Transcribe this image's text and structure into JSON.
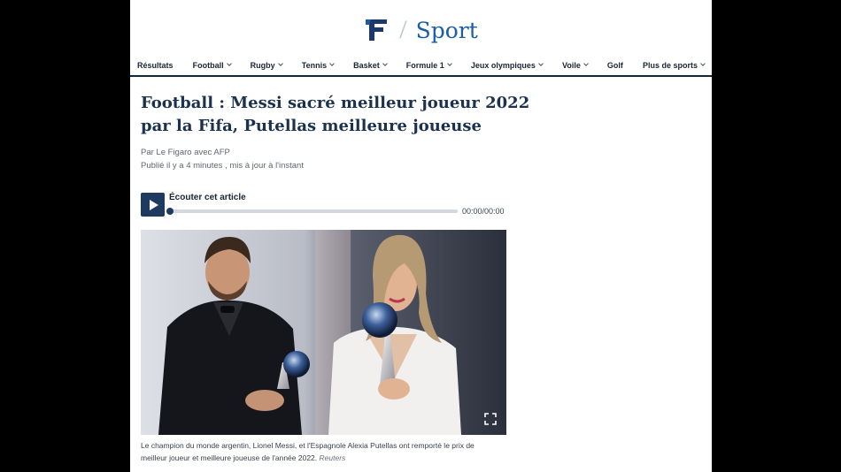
{
  "header": {
    "brand_section": "Sport",
    "logo_icon": "le-figaro-f-logo-icon"
  },
  "nav": {
    "items": [
      {
        "label": "Résultats",
        "has_dropdown": false
      },
      {
        "label": "Football",
        "has_dropdown": true
      },
      {
        "label": "Rugby",
        "has_dropdown": true
      },
      {
        "label": "Tennis",
        "has_dropdown": true
      },
      {
        "label": "Basket",
        "has_dropdown": true
      },
      {
        "label": "Formule 1",
        "has_dropdown": true
      },
      {
        "label": "Jeux olympiques",
        "has_dropdown": true
      },
      {
        "label": "Voile",
        "has_dropdown": true
      },
      {
        "label": "Golf",
        "has_dropdown": false
      },
      {
        "label": "Plus de sports",
        "has_dropdown": true
      }
    ]
  },
  "article": {
    "title": "Football : Messi sacré meilleur joueur 2022 par la Fifa, Putellas meilleure joueuse",
    "byline": "Par Le Figaro avec AFP",
    "published": "Publié il y a 4 minutes , mis à jour à l'instant"
  },
  "player": {
    "label": "Écouter cet article",
    "time": "00:00/00:00",
    "progress": 0,
    "play_icon": "play-icon"
  },
  "photo": {
    "expand_icon": "expand-icon"
  },
  "caption": {
    "text": "Le champion du monde argentin, Lionel Messi, et l'Espagnole Alexia Putellas ont remporté le prix de meilleur joueur et meilleure joueuse de l'année 2022.",
    "credit": "Reuters"
  },
  "colors": {
    "brand_blue": "#1b5ea6",
    "navy": "#1a3150",
    "page_bg": "#ffffff",
    "outer_bg": "#000000"
  }
}
